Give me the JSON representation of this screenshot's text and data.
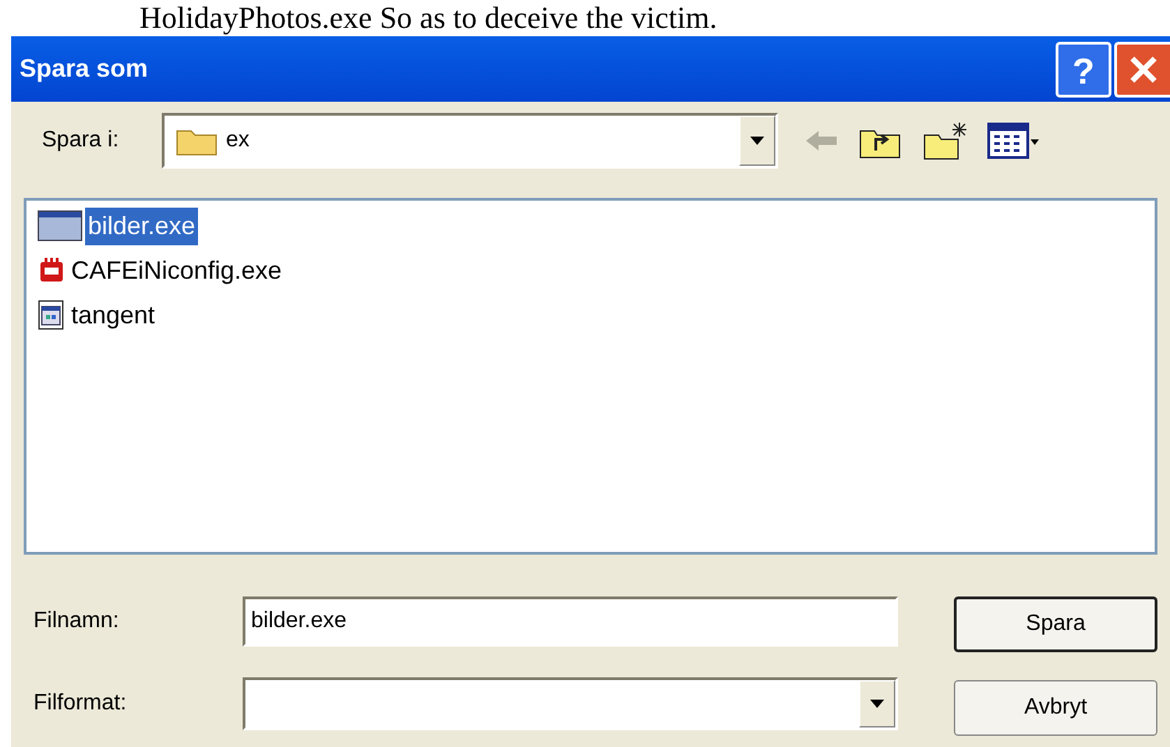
{
  "caption": "HolidayPhotos.exe So as to deceive the victim.",
  "window": {
    "title": "Spara som",
    "help": "?"
  },
  "location": {
    "label": "Spara i:",
    "value": "ex"
  },
  "files": [
    {
      "name": "bilder.exe",
      "kind": "window",
      "selected": true
    },
    {
      "name": "CAFEiNiconfig.exe",
      "kind": "app",
      "selected": false
    },
    {
      "name": "tangent",
      "kind": "document",
      "selected": false
    }
  ],
  "filename": {
    "label": "Filnamn:",
    "value": "bilder.exe"
  },
  "filetype": {
    "label": "Filformat:"
  },
  "buttons": [
    "Spara",
    "Avbryt"
  ]
}
